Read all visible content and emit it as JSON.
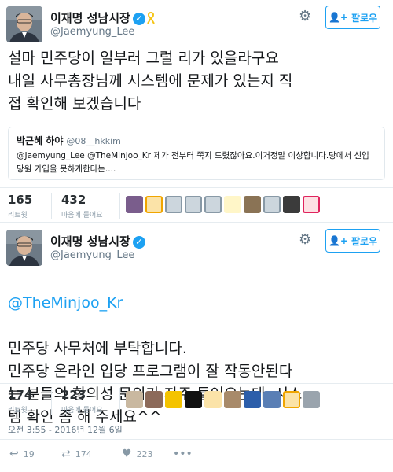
{
  "tweet1": {
    "name": "이재명 성남시장",
    "handle": "@Jaemyung_Lee",
    "follow_label": "팔로우",
    "text": "설마 민주당이 일부러 그럴 리가 있을라구요\n내일 사무총장님께 시스템에 문제가 있는지 직\n접 확인해 보겠습니다",
    "quote": {
      "name": "박근혜 하야",
      "handle": "@08__hkkim",
      "text": "@Jaemyung_Lee @TheMinjoo_Kr 제가 전부터 쭉지 드렸잖아요.이거정말 이상합니다.당에서 신입당원 가입을 못하게한다는...."
    },
    "retweets": "165",
    "retweets_label": "리트윗",
    "likes": "432",
    "likes_label": "마음에 들어요"
  },
  "tweet2": {
    "name": "이재명 성남시장",
    "handle": "@Jaemyung_Lee",
    "follow_label": "팔로우",
    "mention": "@TheMinjoo_Kr",
    "text": "민주당 사무처에 부탁합니다.\n민주당 온라인 입당 프로그램이 잘 작동안된다\n는 분들의 항의성 문의가 자주 들어오는데..시스\n템 확인 좀 해 주세요^^",
    "retweets": "174",
    "retweets_label": "리트윗",
    "likes": "223",
    "likes_label": "마음에 들어요",
    "timestamp": "오전 3:55 - 2016년 12월 6일",
    "actions": {
      "reply_count": "19",
      "retweet_count": "174",
      "like_count": "223"
    }
  },
  "icons": {
    "gear": "gear-icon",
    "follow": "person-plus-icon",
    "verified": "verified-badge-icon",
    "ribbon": "yellow-ribbon-icon",
    "reply": "reply-icon",
    "retweet": "retweet-icon",
    "like": "heart-icon",
    "more": "more-icon"
  },
  "colors": {
    "accent": "#1da1f2",
    "text": "#14171a",
    "muted": "#657786",
    "border": "#e1e8ed"
  }
}
